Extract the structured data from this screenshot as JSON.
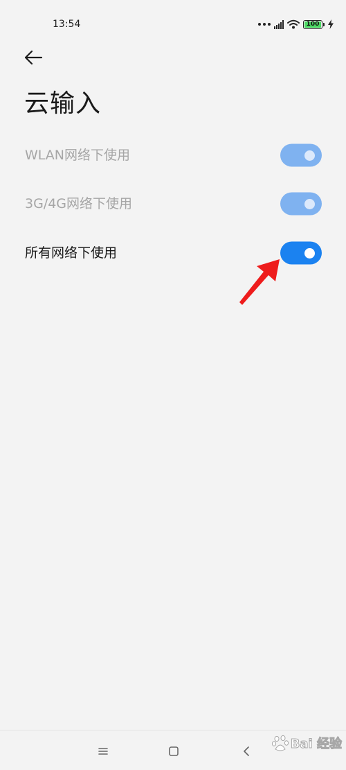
{
  "status_bar": {
    "time": "13:54",
    "battery_level": "100",
    "icons": [
      "dots-icon",
      "signal-icon",
      "wifi-icon",
      "battery-icon",
      "charging-icon"
    ]
  },
  "header": {
    "back_icon": "arrow-left-icon",
    "title": "云输入"
  },
  "settings": [
    {
      "label": "WLAN网络下使用",
      "enabled": false,
      "checked": true
    },
    {
      "label": "3G/4G网络下使用",
      "enabled": false,
      "checked": true
    },
    {
      "label": "所有网络下使用",
      "enabled": true,
      "checked": true
    }
  ],
  "annotation": {
    "icon": "red-arrow-icon",
    "color": "#ee1c1c"
  },
  "nav_bar": {
    "icons": [
      "menu-icon",
      "home-icon",
      "back-icon"
    ]
  },
  "watermark": {
    "text": "Bai  经验"
  },
  "colors": {
    "accent": "#1b82f0",
    "accent_disabled": "#7fb2f0",
    "background": "#f3f3f3",
    "text_primary": "#1a1a1a",
    "text_disabled": "#a6a6a6"
  }
}
